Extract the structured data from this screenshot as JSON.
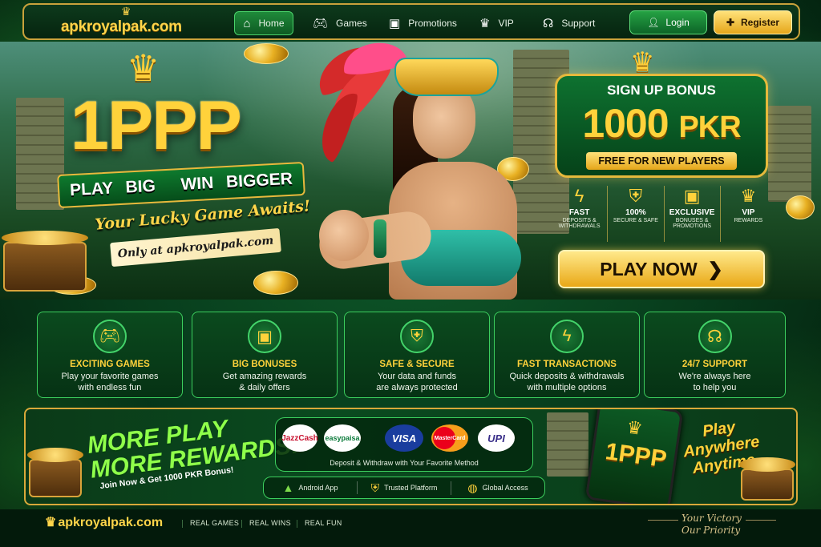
{
  "site": {
    "name": "apkroyalpak.com"
  },
  "nav": {
    "items": [
      {
        "label": "Home",
        "icon": "home-icon"
      },
      {
        "label": "Games",
        "icon": "gamepad-icon"
      },
      {
        "label": "Promotions",
        "icon": "gift-icon"
      },
      {
        "label": "VIP",
        "icon": "crown-icon"
      },
      {
        "label": "Support",
        "icon": "headset-icon"
      }
    ],
    "login_label": "Login",
    "register_label": "Register"
  },
  "hero": {
    "brand": "1PPP",
    "tagline_a": "PLAY BIG",
    "tagline_b": "WIN BIGGER",
    "lucky": "Your Lucky Game Awaits!",
    "only_at": "Only at apkroyalpak.com"
  },
  "signup": {
    "title": "SIGN UP BONUS",
    "amount": "1000",
    "currency": "PKR",
    "subtitle": "FREE FOR NEW PLAYERS",
    "features": [
      {
        "title": "FAST",
        "sub": "DEPOSITS & WITHDRAWALS",
        "icon": "lightning-icon"
      },
      {
        "title": "100%",
        "sub": "SECURE & SAFE",
        "icon": "shield-icon"
      },
      {
        "title": "EXCLUSIVE",
        "sub": "BONUSES & PROMOTIONS",
        "icon": "gift-icon"
      },
      {
        "title": "VIP",
        "sub": "REWARDS",
        "icon": "crown-icon"
      }
    ],
    "cta": "PLAY NOW"
  },
  "cards": [
    {
      "title": "EXCITING GAMES",
      "line1": "Play your favorite games",
      "line2": "with endless fun",
      "icon": "gamepad-icon"
    },
    {
      "title": "BIG BONUSES",
      "line1": "Get amazing rewards",
      "line2": "& daily offers",
      "icon": "gift-icon"
    },
    {
      "title": "SAFE & SECURE",
      "line1": "Your data and funds",
      "line2": "are always protected",
      "icon": "shield-icon"
    },
    {
      "title": "FAST TRANSACTIONS",
      "line1": "Quick deposits & withdrawals",
      "line2": "with multiple options",
      "icon": "lightning-icon"
    },
    {
      "title": "24/7 SUPPORT",
      "line1": "We're always here",
      "line2": "to help you",
      "icon": "headset-icon"
    }
  ],
  "banner": {
    "line1": "MORE PLAY",
    "line2": "MORE REWARDS!",
    "join": "Join Now & Get 1000 PKR Bonus!",
    "payments": [
      "JazzCash",
      "easypaisa",
      "VISA",
      "MasterCard",
      "UPI"
    ],
    "payment_text": "Deposit & Withdraw with Your Favorite Method",
    "trust": [
      {
        "label": "Android App",
        "icon": "android-icon"
      },
      {
        "label": "Trusted Platform",
        "icon": "shield-icon"
      },
      {
        "label": "Global Access",
        "icon": "globe-icon"
      }
    ],
    "phone_brand": "1PPP",
    "anywhere": [
      "Play",
      "Anywhere",
      "Anytime"
    ]
  },
  "footer": {
    "links": [
      "REAL GAMES",
      "REAL WINS",
      "REAL FUN"
    ],
    "slogan1": "Your Victory",
    "slogan2": "Our Priority"
  },
  "colors": {
    "gold": "#ffd23b",
    "green": "#0e7230",
    "accent_green": "#3ccf5e"
  }
}
